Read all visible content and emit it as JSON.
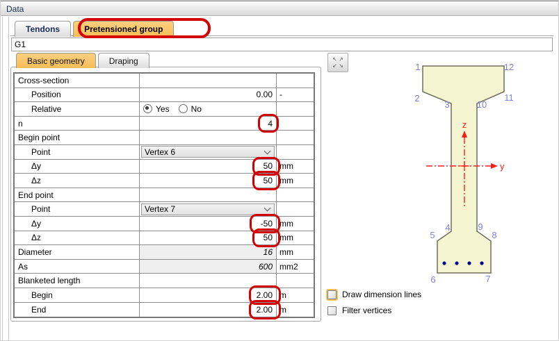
{
  "window": {
    "title": "Data"
  },
  "tabs": {
    "tendons": "Tendons",
    "pretensioned": "Pretensioned group"
  },
  "group_name": {
    "value": "G1"
  },
  "sub_tabs": {
    "basic_geometry": "Basic geometry",
    "draping": "Draping"
  },
  "table": {
    "rows": [
      {
        "label": "Cross-section",
        "type": "group"
      },
      {
        "label": "Position",
        "value": "0.00",
        "unit": "-"
      },
      {
        "label": "Relative",
        "options": [
          "Yes",
          "No"
        ],
        "selected": "Yes"
      },
      {
        "label": "n",
        "value": "4",
        "unit": "",
        "annotated": true
      },
      {
        "label": "Begin point",
        "type": "group"
      },
      {
        "label": "Point",
        "value": "Vertex 6",
        "type": "dropdown"
      },
      {
        "label": "Δy",
        "value": "50",
        "unit": "mm",
        "annotated": true
      },
      {
        "label": "Δz",
        "value": "50",
        "unit": "mm",
        "annotated": true
      },
      {
        "label": "End point",
        "type": "group"
      },
      {
        "label": "Point",
        "value": "Vertex 7",
        "type": "dropdown"
      },
      {
        "label": "Δy",
        "value": "-50",
        "unit": "mm",
        "annotated": true
      },
      {
        "label": "Δz",
        "value": "50",
        "unit": "mm",
        "annotated": true
      },
      {
        "label": "Diameter",
        "value": "16",
        "unit": "mm",
        "type": "readonly"
      },
      {
        "label": "As",
        "value": "600",
        "unit": "mm2",
        "type": "readonly"
      },
      {
        "label": "Blanketed length",
        "type": "group"
      },
      {
        "label": "Begin",
        "value": "2.00",
        "unit": "m",
        "annotated": true
      },
      {
        "label": "End",
        "value": "2.00",
        "unit": "m",
        "annotated": true
      }
    ]
  },
  "diagram": {
    "vertex_labels": [
      "1",
      "2",
      "3",
      "4",
      "5",
      "6",
      "7",
      "8",
      "9",
      "10",
      "11",
      "12"
    ],
    "axes": {
      "vertical": "z",
      "horizontal": "y"
    },
    "strand_count": 4,
    "colors": {
      "beam_fill": "#f5f5d2",
      "beam_outline": "#6e6e5c",
      "vertex_label": "#8080dd",
      "axis_red": "#ff1a1a",
      "strand_dot": "#00008b"
    }
  },
  "options": [
    {
      "label": "Draw dimension lines",
      "checked": false
    },
    {
      "label": "Filter vertices",
      "checked": false
    }
  ],
  "colors": {
    "active_tab": "#f6bd57",
    "annotation_red": "#d40000"
  }
}
